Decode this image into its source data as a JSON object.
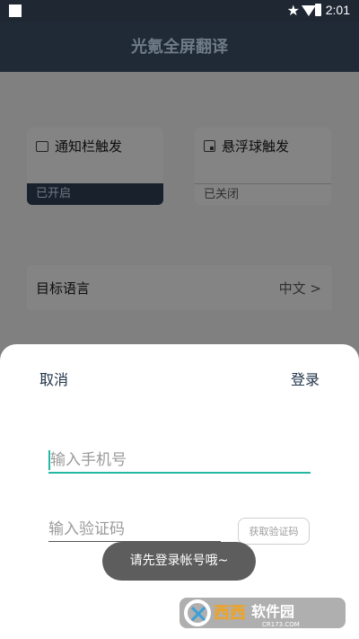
{
  "status_bar": {
    "time": "2:01"
  },
  "app_bar": {
    "title": "光氪全屏翻译"
  },
  "cards": {
    "notification": {
      "title": "通知栏触发",
      "status": "已开启"
    },
    "floating_ball": {
      "title": "悬浮球触发",
      "status": "已关闭"
    }
  },
  "target_language": {
    "label": "目标语言",
    "value": "中文 >"
  },
  "login_sheet": {
    "cancel": "取消",
    "login": "登录",
    "phone_placeholder": "输入手机号",
    "code_placeholder": "输入验证码",
    "get_code": "获取验证码"
  },
  "toast": "请先登录帐号哦~",
  "watermark": {
    "brand": "西西软件园",
    "domain": "CR173.COM"
  },
  "colors": {
    "accent": "#22b8a2",
    "app_bar": "#202a36",
    "toast": "#5d5d5d"
  }
}
